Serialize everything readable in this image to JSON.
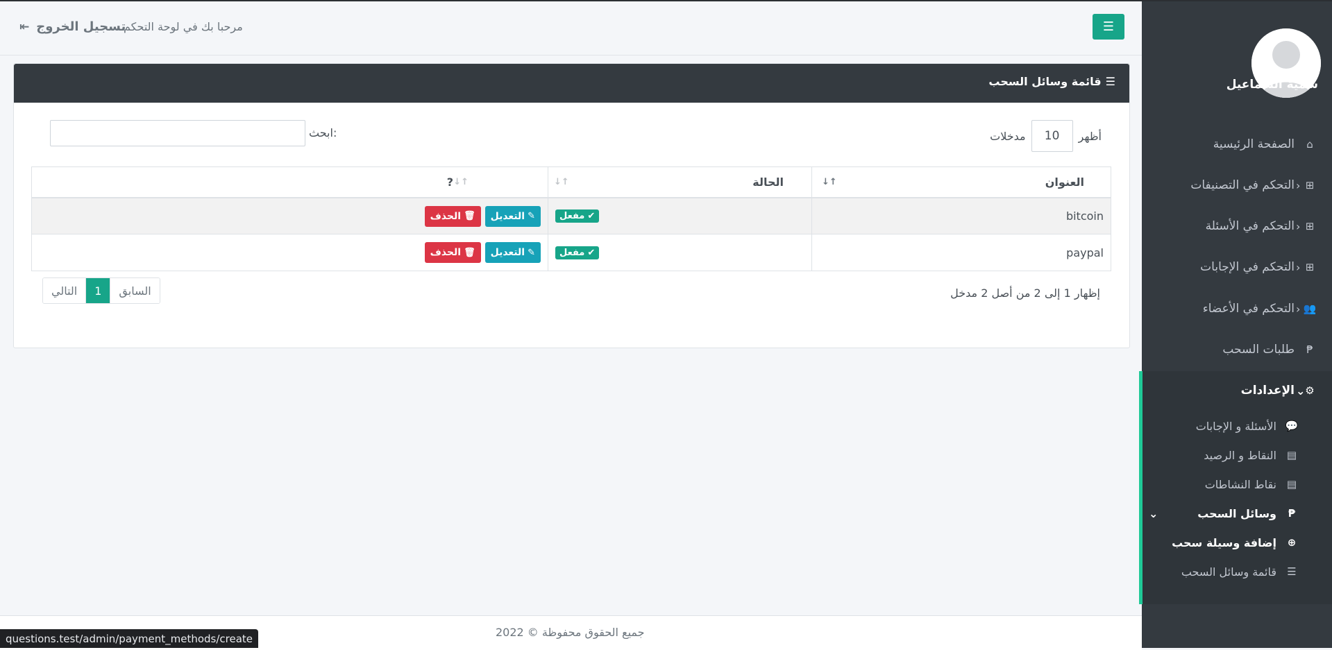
{
  "sidebar": {
    "username": "سمية السماعيل",
    "items": [
      {
        "label": "الصفحة الرئيسية",
        "icon": "home-icon"
      },
      {
        "label": "التحكم في التصنيفات",
        "icon": "grid-icon"
      },
      {
        "label": "التحكم في الأسئلة",
        "icon": "grid-icon"
      },
      {
        "label": "التحكم في الإجابات",
        "icon": "grid-icon"
      },
      {
        "label": "التحكم في الأعضاء",
        "icon": "users-icon"
      },
      {
        "label": "طلبات السحب",
        "icon": "paypal-icon"
      },
      {
        "label": "الإعدادات",
        "icon": "gear-icon"
      },
      {
        "label": "الأسئلة و الإجابات",
        "icon": "comments-icon"
      },
      {
        "label": "النقاط و الرصيد",
        "icon": "cash-register-icon"
      },
      {
        "label": "نقاط النشاطات",
        "icon": "cash-register-icon"
      },
      {
        "label": "وسائل السحب",
        "icon": "paypal-icon"
      },
      {
        "label": "إضافة وسيلة سحب",
        "icon": "plus-circle-icon"
      },
      {
        "label": "قائمة وسائل السحب",
        "icon": "list-icon"
      }
    ]
  },
  "topbar": {
    "welcome": "مرحبا بك في لوحة التحكم",
    "logout": "تسجيل الخروج"
  },
  "card": {
    "title": "قائمة وسائل السحب",
    "length": {
      "show": "أظهر",
      "value": "10",
      "entries": "مدخلات"
    },
    "search_label": "ابحث:",
    "search_value": "",
    "columns": [
      "العنوان",
      "الحالة",
      "?"
    ],
    "rows": [
      {
        "title": "bitcoin",
        "status": "مفعل",
        "edit": "التعديل",
        "delete": "الحذف"
      },
      {
        "title": "paypal",
        "status": "مفعل",
        "edit": "التعديل",
        "delete": "الحذف"
      }
    ],
    "info": "إظهار 1 إلى 2 من أصل 2 مدخل",
    "pager": {
      "prev": "السابق",
      "page": "1",
      "next": "التالي"
    }
  },
  "footer": {
    "text": "جميع الحقوق محفوظة © 2022"
  },
  "statusbar": {
    "url": "questions.test/admin/payment_methods/create"
  },
  "colors": {
    "accent": "#17a589",
    "sidebar": "#343a40",
    "edit": "#17a2b8",
    "delete": "#dc3545"
  }
}
